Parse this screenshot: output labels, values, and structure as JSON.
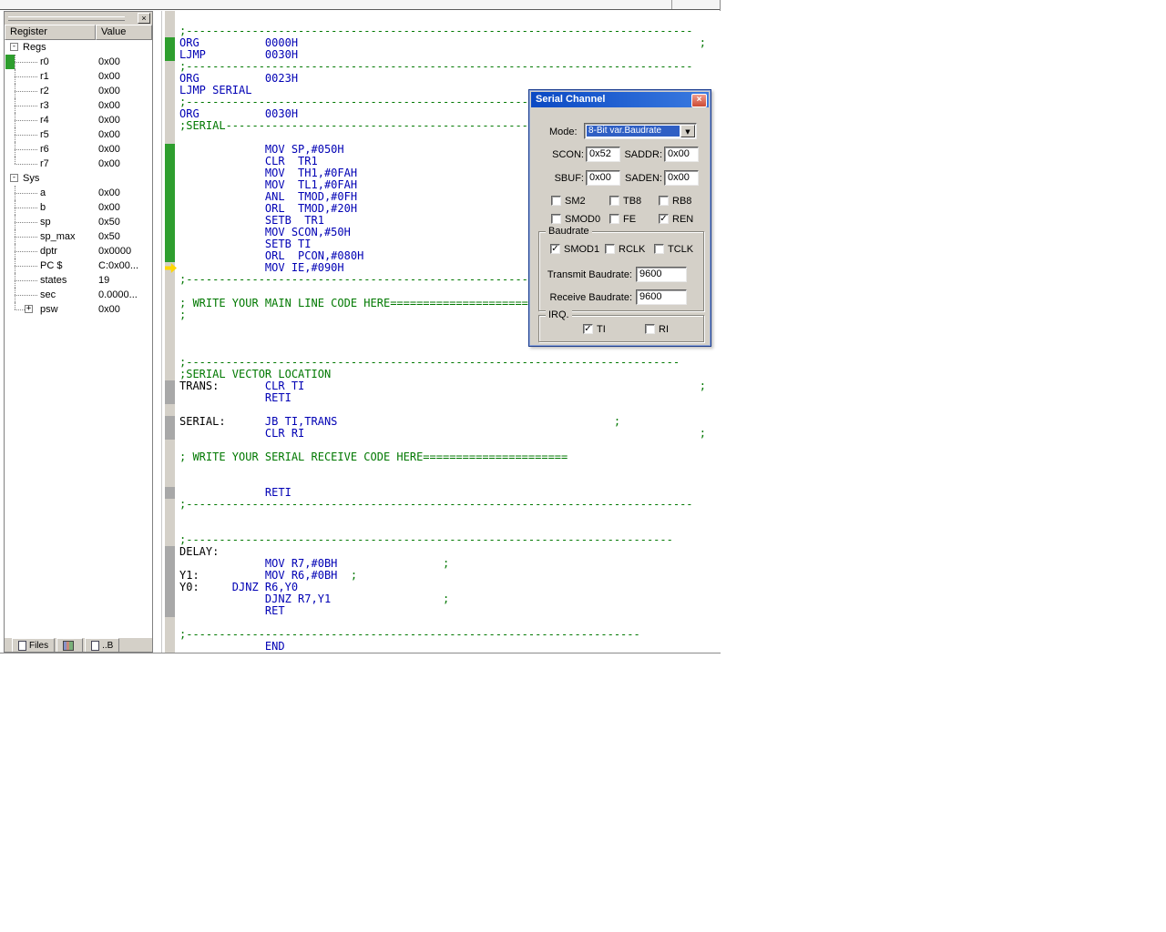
{
  "colors": {
    "comment_green": "#007800",
    "code_blue": "#0000b4",
    "coverage_green": "#2e9e2e",
    "titlebar_blue": "#0b49c3",
    "chrome_gray": "#d4d0c8"
  },
  "icons": {
    "combo_arrow": "▼",
    "close_glyph": "×",
    "collapse_glyph": "-",
    "expand_glyph": "+"
  },
  "register_panel": {
    "close_glyph": "×",
    "columns": [
      "Register",
      "Value"
    ],
    "rows": [
      {
        "label": "Regs",
        "type": "group",
        "value": "",
        "expander": "-"
      },
      {
        "label": "r0",
        "type": "child",
        "value": "0x00",
        "marker": true
      },
      {
        "label": "r1",
        "type": "child",
        "value": "0x00"
      },
      {
        "label": "r2",
        "type": "child",
        "value": "0x00"
      },
      {
        "label": "r3",
        "type": "child",
        "value": "0x00"
      },
      {
        "label": "r4",
        "type": "child",
        "value": "0x00"
      },
      {
        "label": "r5",
        "type": "child",
        "value": "0x00"
      },
      {
        "label": "r6",
        "type": "child",
        "value": "0x00"
      },
      {
        "label": "r7",
        "type": "child",
        "value": "0x00",
        "last": true
      },
      {
        "label": "Sys",
        "type": "group",
        "value": "",
        "expander": "-"
      },
      {
        "label": "a",
        "type": "child",
        "value": "0x00"
      },
      {
        "label": "b",
        "type": "child",
        "value": "0x00"
      },
      {
        "label": "sp",
        "type": "child",
        "value": "0x50"
      },
      {
        "label": "sp_max",
        "type": "child",
        "value": "0x50"
      },
      {
        "label": "dptr",
        "type": "child",
        "value": "0x0000"
      },
      {
        "label": "PC $",
        "type": "child",
        "value": "C:0x00..."
      },
      {
        "label": "states",
        "type": "child",
        "value": "19"
      },
      {
        "label": "sec",
        "type": "child",
        "value": "0.0000..."
      },
      {
        "label": "psw",
        "type": "child",
        "value": "0x00",
        "expander": "+",
        "last": true
      }
    ],
    "tabs": [
      {
        "label": "Files"
      },
      {
        "label": ""
      },
      {
        "label": "..B"
      }
    ]
  },
  "editor": {
    "lines": [
      {
        "m": "",
        "s": [
          [
            "cm",
            ";-----------------------------------------------------------------------------"
          ]
        ]
      },
      {
        "m": "g",
        "s": [
          [
            "kw",
            "ORG          0000H"
          ],
          [
            "cm",
            "                                                             ;"
          ]
        ]
      },
      {
        "m": "g",
        "s": [
          [
            "kw",
            "LJMP         0030H"
          ]
        ]
      },
      {
        "m": "",
        "s": [
          [
            "cm",
            ";-----------------------------------------------------------------------------"
          ]
        ]
      },
      {
        "m": "",
        "s": [
          [
            "kw",
            "ORG          0023H"
          ]
        ]
      },
      {
        "m": "",
        "s": [
          [
            "kw",
            "LJMP SERIAL"
          ]
        ]
      },
      {
        "m": "",
        "s": [
          [
            "cm",
            ";-----------------------------------------------------------------------------"
          ]
        ]
      },
      {
        "m": "",
        "s": [
          [
            "kw",
            "ORG          0030H"
          ]
        ]
      },
      {
        "m": "",
        "s": [
          [
            "cm",
            ";SERIAL-----------------------------------------------------"
          ]
        ]
      },
      {
        "m": "",
        "s": []
      },
      {
        "m": "g",
        "s": [
          [
            "kw",
            "             MOV SP,#050H"
          ]
        ]
      },
      {
        "m": "g",
        "s": [
          [
            "kw",
            "             CLR  TR1"
          ]
        ]
      },
      {
        "m": "g",
        "s": [
          [
            "kw",
            "             MOV  TH1,#0FAH"
          ]
        ]
      },
      {
        "m": "g",
        "s": [
          [
            "kw",
            "             MOV  TL1,#0FAH"
          ]
        ]
      },
      {
        "m": "g",
        "s": [
          [
            "kw",
            "             ANL  TMOD,#0FH"
          ]
        ]
      },
      {
        "m": "g",
        "s": [
          [
            "kw",
            "             ORL  TMOD,#20H"
          ]
        ]
      },
      {
        "m": "g",
        "s": [
          [
            "kw",
            "             SETB  TR1"
          ]
        ]
      },
      {
        "m": "g",
        "s": [
          [
            "kw",
            "             MOV SCON,#50H"
          ]
        ]
      },
      {
        "m": "g",
        "s": [
          [
            "kw",
            "             SETB TI"
          ]
        ]
      },
      {
        "m": "g",
        "s": [
          [
            "kw",
            "             ORL  PCON,#080H"
          ]
        ]
      },
      {
        "m": "a",
        "s": [
          [
            "kw",
            "             MOV IE,#090H"
          ]
        ]
      },
      {
        "m": "",
        "s": [
          [
            "cm",
            ";-----------------------------------------------------------------------------"
          ]
        ]
      },
      {
        "m": "",
        "s": []
      },
      {
        "m": "",
        "s": [
          [
            "cm",
            "; WRITE YOUR MAIN LINE CODE HERE====================="
          ]
        ]
      },
      {
        "m": "",
        "s": [
          [
            "cm",
            ";"
          ]
        ]
      },
      {
        "m": "",
        "s": []
      },
      {
        "m": "",
        "s": []
      },
      {
        "m": "",
        "s": []
      },
      {
        "m": "",
        "s": [
          [
            "cm",
            ";---------------------------------------------------------------------------"
          ]
        ]
      },
      {
        "m": "",
        "s": [
          [
            "cm",
            ";SERIAL VECTOR LOCATION"
          ]
        ]
      },
      {
        "m": "y",
        "s": [
          [
            "lb",
            "TRANS:"
          ],
          [
            "kw",
            "       CLR TI"
          ],
          [
            "cm",
            "                                                            ;"
          ]
        ]
      },
      {
        "m": "y",
        "s": [
          [
            "kw",
            "             RETI"
          ]
        ]
      },
      {
        "m": "",
        "s": []
      },
      {
        "m": "y",
        "s": [
          [
            "lb",
            "SERIAL:"
          ],
          [
            "kw",
            "      JB TI,TRANS"
          ],
          [
            "cm",
            "                                          ;"
          ]
        ]
      },
      {
        "m": "y",
        "s": [
          [
            "kw",
            "             CLR RI"
          ],
          [
            "cm",
            "                                                            ;"
          ]
        ]
      },
      {
        "m": "",
        "s": []
      },
      {
        "m": "",
        "s": [
          [
            "cm",
            "; WRITE YOUR SERIAL RECEIVE CODE HERE======================"
          ]
        ]
      },
      {
        "m": "",
        "s": []
      },
      {
        "m": "",
        "s": []
      },
      {
        "m": "y",
        "s": [
          [
            "kw",
            "             RETI"
          ]
        ]
      },
      {
        "m": "",
        "s": [
          [
            "cm",
            ";-----------------------------------------------------------------------------"
          ]
        ]
      },
      {
        "m": "",
        "s": []
      },
      {
        "m": "",
        "s": []
      },
      {
        "m": "",
        "s": [
          [
            "cm",
            ";--------------------------------------------------------------------------"
          ]
        ]
      },
      {
        "m": "y",
        "s": [
          [
            "lb",
            "DELAY:"
          ]
        ]
      },
      {
        "m": "y",
        "s": [
          [
            "kw",
            "             MOV R7,#0BH"
          ],
          [
            "cm",
            "                ;"
          ]
        ]
      },
      {
        "m": "y",
        "s": [
          [
            "lb",
            "Y1:"
          ],
          [
            "kw",
            "          MOV R6,#0BH"
          ],
          [
            "cm",
            "  ;"
          ]
        ]
      },
      {
        "m": "y",
        "s": [
          [
            "lb",
            "Y0:"
          ],
          [
            "kw",
            "     DJNZ R6,Y0"
          ]
        ]
      },
      {
        "m": "y",
        "s": [
          [
            "kw",
            "             DJNZ R7,Y1"
          ],
          [
            "cm",
            "                 ;"
          ]
        ]
      },
      {
        "m": "y",
        "s": [
          [
            "kw",
            "             RET"
          ]
        ]
      },
      {
        "m": "",
        "s": []
      },
      {
        "m": "",
        "s": [
          [
            "cm",
            ";---------------------------------------------------------------------"
          ]
        ]
      },
      {
        "m": "",
        "s": [
          [
            "kw",
            "             END"
          ]
        ]
      }
    ]
  },
  "dialog": {
    "title": "Serial Channel",
    "close_glyph": "×",
    "mode_label": "Mode:",
    "mode_value": "8-Bit var.Baudrate",
    "fields": [
      {
        "label": "SCON:",
        "value": "0x52"
      },
      {
        "label": "SADDR:",
        "value": "0x00"
      },
      {
        "label": "SBUF:",
        "value": "0x00"
      },
      {
        "label": "SADEN:",
        "value": "0x00"
      }
    ],
    "checks_row1": [
      {
        "label": "SM2",
        "checked": false
      },
      {
        "label": "TB8",
        "checked": false
      },
      {
        "label": "RB8",
        "checked": false
      }
    ],
    "checks_row2": [
      {
        "label": "SMOD0",
        "checked": false
      },
      {
        "label": "FE",
        "checked": false
      },
      {
        "label": "REN",
        "checked": true
      }
    ],
    "baudrate": {
      "legend": "Baudrate",
      "checks": [
        {
          "label": "SMOD1",
          "checked": true
        },
        {
          "label": "RCLK",
          "checked": false
        },
        {
          "label": "TCLK",
          "checked": false
        }
      ],
      "rows": [
        {
          "label": "Transmit Baudrate:",
          "value": "9600"
        },
        {
          "label": "Receive Baudrate:",
          "value": "9600"
        }
      ]
    },
    "irq": {
      "legend": "IRQ.",
      "checks": [
        {
          "label": "TI",
          "checked": true
        },
        {
          "label": "RI",
          "checked": false
        }
      ]
    }
  }
}
